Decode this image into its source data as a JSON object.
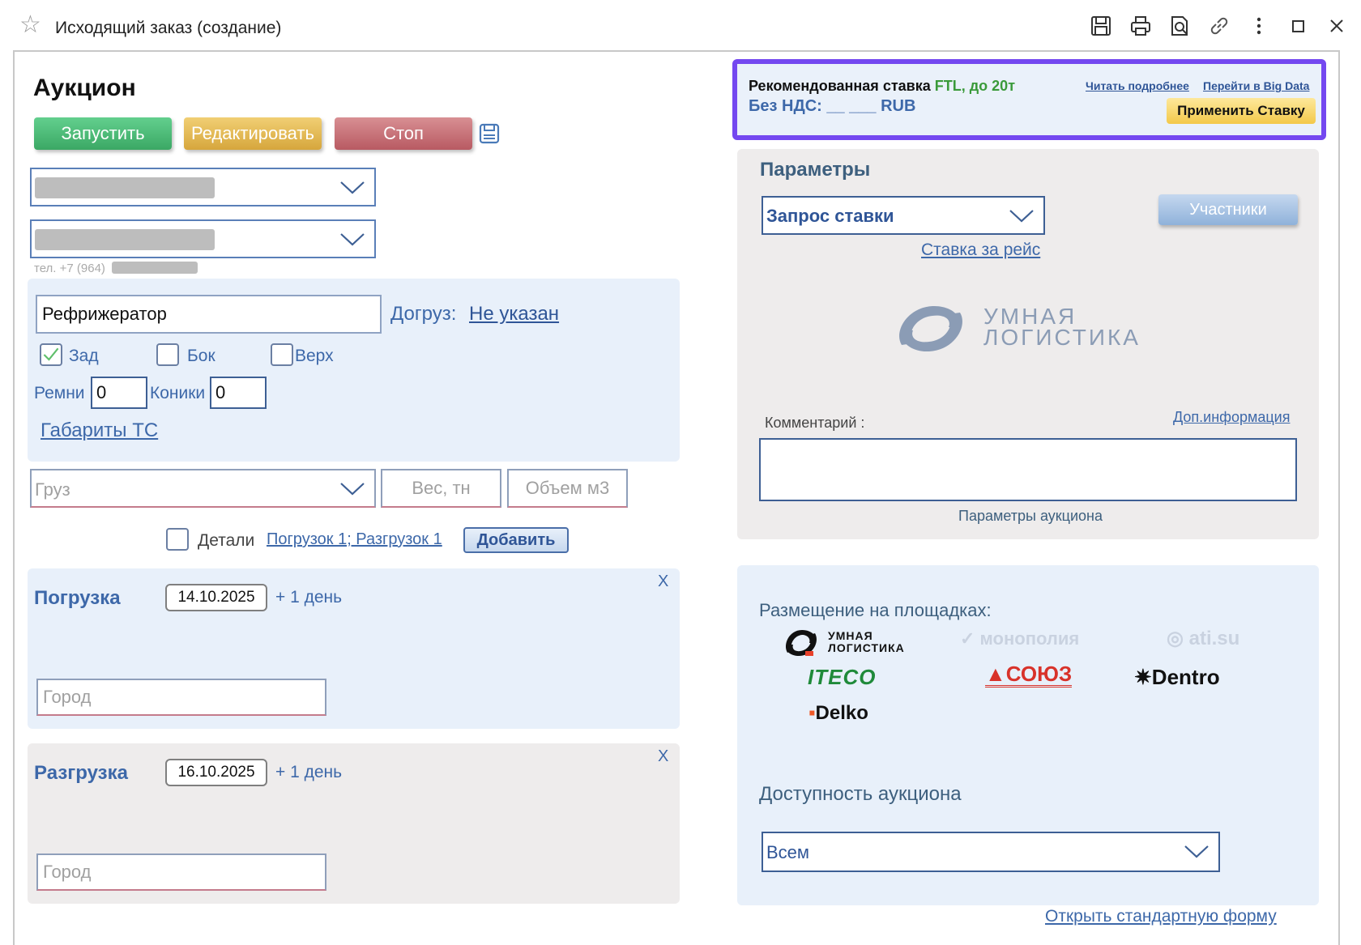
{
  "window": {
    "title": "Исходящий заказ (создание)"
  },
  "auction": {
    "heading": "Аукцион",
    "start_label": "Запустить",
    "edit_label": "Редактировать",
    "stop_label": "Стоп",
    "phone_prefix": "тел. +7 (964)"
  },
  "cargo": {
    "body_type": "Рефрижератор",
    "extra_load_label": "Догруз:",
    "extra_load_value": "Не указан",
    "loading": {
      "rear": "Зад",
      "side": "Бок",
      "top": "Верх"
    },
    "straps_label": "Ремни",
    "straps_value": "0",
    "cones_label": "Коники",
    "cones_value": "0",
    "dimensions_link": "Габариты ТС",
    "cargo_placeholder": "Груз",
    "weight_placeholder": "Вес, тн",
    "volume_placeholder": "Объем м3",
    "details_label": "Детали",
    "details_link": "Погрузок 1; Разгрузок 1",
    "add_label": "Добавить"
  },
  "loading_point": {
    "title": "Погрузка",
    "date": "14.10.2025",
    "plus": "+ 1 день",
    "city_placeholder": "Город",
    "close": "X"
  },
  "unloading_point": {
    "title": "Разгрузка",
    "date": "16.10.2025",
    "plus": "+ 1 день",
    "city_placeholder": "Город",
    "close": "X"
  },
  "recommendation": {
    "label": "Рекомендованная ставка",
    "type": "FTL, до 20т",
    "vat_line": "Без НДС: __ ___ RUB",
    "read_more": "Читать подробнее",
    "big_data": "Перейти в Big Data",
    "apply": "Применить Ставку"
  },
  "params": {
    "heading": "Параметры",
    "request_type": "Запрос ставки",
    "participants": "Участники",
    "rate_link": "Ставка за рейс",
    "logo_line1": "УМНАЯ",
    "logo_line2": "ЛОГИСТИКА",
    "comment_label": "Комментарий :",
    "extra_info_link": "Доп.информация",
    "auction_params": "Параметры аукциона"
  },
  "placement": {
    "heading": "Размещение на площадках:",
    "platforms": {
      "umnaya_line1": "УМНАЯ",
      "umnaya_line2": "ЛОГИСТИКА",
      "monopoly": "монополия",
      "ati": "ati.su",
      "iteco": "ITECO",
      "soyuz": "СОЮЗ",
      "dentro": "Dentro",
      "delko": "Delko"
    },
    "availability_heading": "Доступность аукциона",
    "availability_value": "Всем"
  },
  "footer": {
    "standard_form_link": "Открыть стандартную форму"
  },
  "colors": {
    "accent_purple": "#7448f0",
    "link_blue": "#2f5597",
    "green_text": "#3a9a3a"
  }
}
